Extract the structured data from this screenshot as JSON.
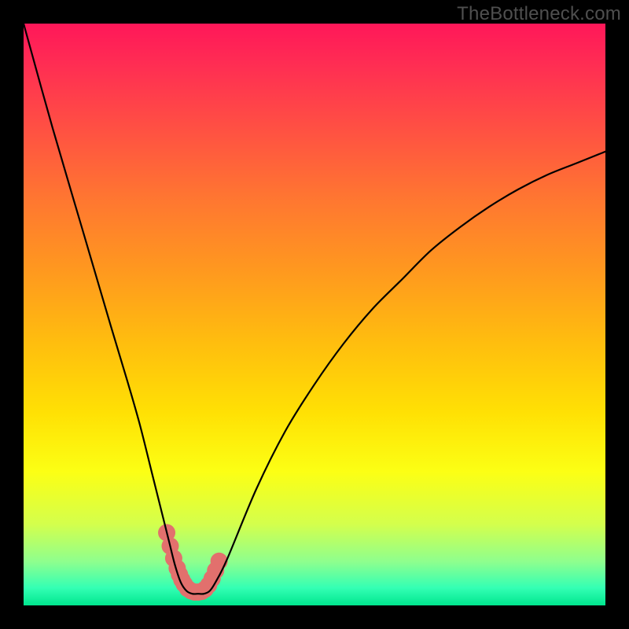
{
  "watermark": "TheBottleneck.com",
  "chart_data": {
    "type": "line",
    "title": "",
    "xlabel": "",
    "ylabel": "",
    "xlim": [
      0,
      100
    ],
    "ylim": [
      0,
      100
    ],
    "series": [
      {
        "name": "curve",
        "x": [
          0,
          5,
          10,
          15,
          18,
          20,
          22,
          24,
          25,
          26,
          27,
          28,
          29,
          30,
          31,
          32,
          33,
          35,
          40,
          45,
          50,
          55,
          60,
          65,
          70,
          75,
          80,
          85,
          90,
          95,
          100
        ],
        "values": [
          100,
          82,
          65,
          48,
          38,
          31,
          23,
          15,
          11,
          7,
          4,
          2.5,
          2,
          2,
          2,
          2.5,
          4,
          8,
          20,
          30,
          38,
          45,
          51,
          56,
          61,
          65,
          68.5,
          71.5,
          74,
          76,
          78
        ]
      }
    ],
    "dots": {
      "name": "bottom-dots",
      "x": [
        24.6,
        25.2,
        25.8,
        26.4,
        26.8,
        27.2,
        27.6,
        28.2,
        28.8,
        29.4,
        30.0,
        30.6,
        31.2,
        31.8,
        32.4,
        33.0,
        33.6
      ],
      "values": [
        12.5,
        10.2,
        8.1,
        6.4,
        5.3,
        4.4,
        3.7,
        2.9,
        2.5,
        2.3,
        2.3,
        2.4,
        2.8,
        3.5,
        4.6,
        6.0,
        7.6
      ],
      "color": "#e2706d",
      "radius": 11
    },
    "gradient_stops": [
      {
        "offset": 0.0,
        "color": "#ff1759"
      },
      {
        "offset": 0.07,
        "color": "#ff2d53"
      },
      {
        "offset": 0.18,
        "color": "#ff5043"
      },
      {
        "offset": 0.3,
        "color": "#ff7631"
      },
      {
        "offset": 0.43,
        "color": "#ff9a1e"
      },
      {
        "offset": 0.55,
        "color": "#ffbe0e"
      },
      {
        "offset": 0.67,
        "color": "#ffe104"
      },
      {
        "offset": 0.77,
        "color": "#fcff14"
      },
      {
        "offset": 0.86,
        "color": "#d4ff4c"
      },
      {
        "offset": 0.925,
        "color": "#8eff8e"
      },
      {
        "offset": 0.97,
        "color": "#33ffb4"
      },
      {
        "offset": 1.0,
        "color": "#00e68e"
      }
    ]
  }
}
